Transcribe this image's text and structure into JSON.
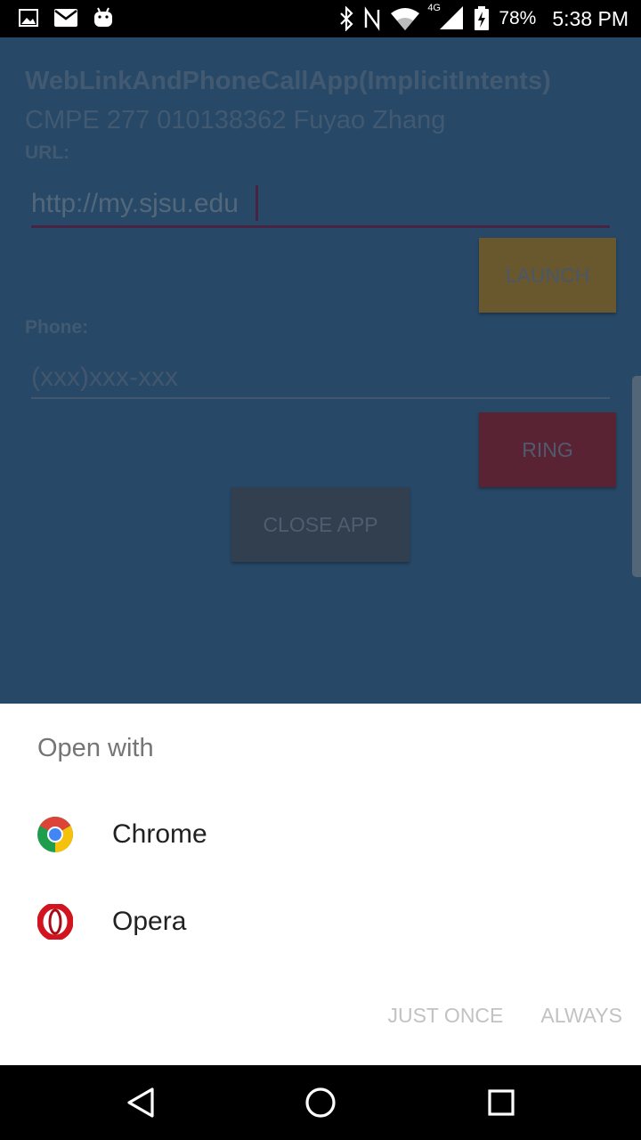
{
  "status_bar": {
    "battery": "78%",
    "time": "5:38 PM",
    "network": "4G",
    "icons": [
      "image-icon",
      "mail-icon",
      "android-icon",
      "bluetooth-icon",
      "nfc-icon",
      "wifi-icon",
      "signal-icon",
      "battery-icon"
    ]
  },
  "app": {
    "title": "WebLinkAndPhoneCallApp(ImplicitIntents)",
    "subtitle": "CMPE 277 010138362 Fuyao Zhang",
    "url_label": "URL:",
    "url_value": "http://my.sjsu.edu",
    "launch_label": "LAUNCH",
    "phone_label": "Phone:",
    "phone_placeholder": "(xxx)xxx-xxx",
    "ring_label": "RING",
    "close_label": "CLOSE APP"
  },
  "sheet": {
    "title": "Open with",
    "apps": [
      {
        "name": "Chrome",
        "icon": "chrome-icon"
      },
      {
        "name": "Opera",
        "icon": "opera-icon"
      }
    ],
    "just_once": "JUST ONCE",
    "always": "ALWAYS"
  },
  "nav": {
    "buttons": [
      "back-icon",
      "home-icon",
      "recents-icon"
    ]
  },
  "colors": {
    "launch": "#b68a32",
    "ring": "#9b2c3e",
    "app_bg": "#3e6f9a",
    "url_underline": "#7a2f58"
  }
}
